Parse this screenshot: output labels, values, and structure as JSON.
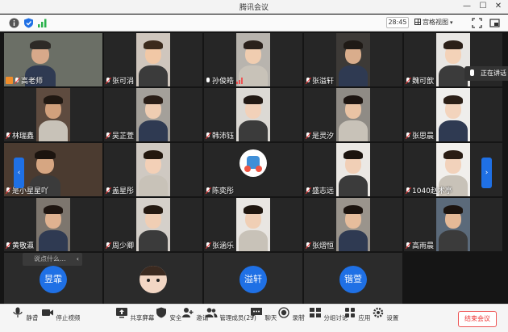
{
  "window": {
    "title": "腾讯会议",
    "minimize": "—",
    "maximize": "☐",
    "close": "✕"
  },
  "infobar": {
    "timer": "28:45",
    "view_label": "宫格视图"
  },
  "tiles": [
    {
      "name": "高老师",
      "host": true
    },
    {
      "name": "张可涓"
    },
    {
      "name": "孙俊皓",
      "speaking": true
    },
    {
      "name": "张溢轩"
    },
    {
      "name": "魏可歆"
    },
    {
      "name": "林瑞鑫"
    },
    {
      "name": "吴芷萱"
    },
    {
      "name": "韩沛钰"
    },
    {
      "name": "是灵汐"
    },
    {
      "name": "张思晨"
    },
    {
      "name": "是小星星吖"
    },
    {
      "name": "盖星彤"
    },
    {
      "name": "陈奕彤"
    },
    {
      "name": "盛志远"
    },
    {
      "name": "1040赵术亭"
    },
    {
      "name": "黄敬瀛"
    },
    {
      "name": "周少卿"
    },
    {
      "name": "张涵乐"
    },
    {
      "name": "张熠恒"
    },
    {
      "name": "高雨晨"
    },
    {
      "avatar_text": "昱霏"
    },
    {
      "name": ""
    },
    {
      "avatar_text": "溢轩"
    },
    {
      "avatar_text": "锴萱"
    }
  ],
  "popup": {
    "label": "正在讲话"
  },
  "chat_input": {
    "placeholder": "说点什么..."
  },
  "toolbar": {
    "mute": "静音",
    "stop_video": "停止视频",
    "share": "共享屏幕",
    "security": "安全",
    "invite": "邀请",
    "members": "管理成员(29)",
    "chat": "聊天",
    "record": "录制",
    "breakout": "分组讨论",
    "apps": "应用",
    "settings": "设置",
    "end_meeting": "结束会议"
  },
  "colors": {
    "accent": "#1f70e5",
    "end": "#e53935",
    "host_badge": "#f08d2b"
  }
}
